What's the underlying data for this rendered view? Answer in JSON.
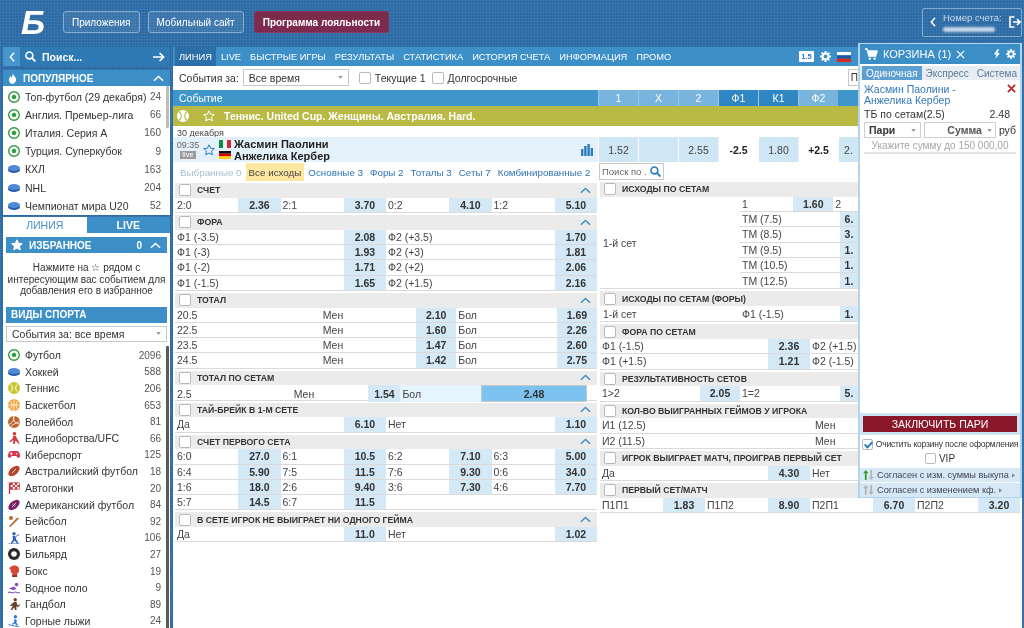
{
  "header": {
    "logo": "Б",
    "buttons": [
      {
        "label": "Приложения",
        "kind": "outline"
      },
      {
        "label": "Мобильный сайт",
        "kind": "outline"
      },
      {
        "label": "Программа лояльности",
        "kind": "primary"
      }
    ],
    "account": {
      "label": "Номер счета:"
    }
  },
  "sidebar": {
    "search": {
      "placeholder": "Поиск..."
    },
    "popular": {
      "title": "ПОПУЛЯРНОЕ",
      "expanded": true,
      "items": [
        {
          "label": "Топ-футбол (29 декабря)",
          "count": "24",
          "kind": "football"
        },
        {
          "label": "Англия. Премьер-лига",
          "count": "66",
          "kind": "football"
        },
        {
          "label": "Италия. Серия А",
          "count": "160",
          "kind": "football"
        },
        {
          "label": "Турция. Суперкубок",
          "count": "9",
          "kind": "football"
        },
        {
          "label": "КХЛ",
          "count": "163",
          "kind": "hockey"
        },
        {
          "label": "NHL",
          "count": "204",
          "kind": "hockey"
        },
        {
          "label": "Чемпионат мира U20",
          "count": "52",
          "kind": "hockey"
        }
      ]
    },
    "tabs": [
      {
        "label": "ЛИНИЯ",
        "selected": true
      },
      {
        "label": "LIVE",
        "selected": false
      }
    ],
    "favorites": {
      "title": "ИЗБРАННОЕ",
      "count": "0",
      "expanded": true,
      "hint": "Нажмите на ☆ рядом с интересующим вас событием для добавления его в избранное"
    },
    "sports": {
      "title": "ВИДЫ СПОРТА",
      "period": "События за: все время",
      "items": [
        {
          "label": "Футбол",
          "count": "2096",
          "kind": "football"
        },
        {
          "label": "Хоккей",
          "count": "588",
          "kind": "hockey"
        },
        {
          "label": "Теннис",
          "count": "206",
          "kind": "tennis"
        },
        {
          "label": "Баскетбол",
          "count": "653",
          "kind": "basketball"
        },
        {
          "label": "Волейбол",
          "count": "81",
          "kind": "volleyball"
        },
        {
          "label": "Единоборства/UFC",
          "count": "66",
          "kind": "fighting"
        },
        {
          "label": "Киберспорт",
          "count": "125",
          "kind": "esports"
        },
        {
          "label": "Австралийский футбол",
          "count": "18",
          "kind": "aussie_football"
        },
        {
          "label": "Автогонки",
          "count": "20",
          "kind": "racing"
        },
        {
          "label": "Американский футбол",
          "count": "84",
          "kind": "american_football"
        },
        {
          "label": "Бейсбол",
          "count": "92",
          "kind": "baseball"
        },
        {
          "label": "Биатлон",
          "count": "106",
          "kind": "biathlon"
        },
        {
          "label": "Бильярд",
          "count": "27",
          "kind": "billiards"
        },
        {
          "label": "Бокс",
          "count": "19",
          "kind": "boxing"
        },
        {
          "label": "Водное поло",
          "count": "9",
          "kind": "water_polo"
        },
        {
          "label": "Гандбол",
          "count": "89",
          "kind": "handball"
        },
        {
          "label": "Горные лыжи",
          "count": "24",
          "kind": "skiing"
        }
      ]
    }
  },
  "main": {
    "nav": {
      "items": [
        {
          "label": "ЛИНИЯ",
          "selected": true
        },
        {
          "label": "LIVE",
          "selected": false
        },
        {
          "label": "БЫСТРЫЕ ИГРЫ",
          "selected": false
        },
        {
          "label": "РЕЗУЛЬТАТЫ",
          "selected": false
        },
        {
          "label": "СТАТИСТИКА",
          "selected": false
        },
        {
          "label": "ИСТОРИЯ СЧЕТА",
          "selected": false
        },
        {
          "label": "ИНФОРМАЦИЯ",
          "selected": false
        },
        {
          "label": "ПРОМО",
          "selected": false
        }
      ],
      "odds_format": "1.5"
    },
    "filters": {
      "label": "События за:",
      "period": "Все время",
      "checkboxes": [
        {
          "label": "Текущие 1",
          "checked": false
        },
        {
          "label": "Долгосрочные",
          "checked": false
        }
      ],
      "cut_off_field": "П"
    },
    "event_column": "Событие",
    "odds_columns": [
      {
        "label": "1",
        "highlighted": false
      },
      {
        "label": "X",
        "highlighted": false
      },
      {
        "label": "2",
        "highlighted": false
      },
      {
        "label": "Ф1",
        "highlighted": true
      },
      {
        "label": "К1",
        "highlighted": true
      },
      {
        "label": "Ф2",
        "highlighted": false
      }
    ],
    "tournament": {
      "title": "Теннис. United Cup. Женщины. Австралия. Hard.",
      "favorite": false
    },
    "date": "30 декабря",
    "event": {
      "time": "09:35",
      "badge": "live",
      "favorite": false,
      "teams": [
        {
          "name": "Жасмин Паолини",
          "kind": "italy"
        },
        {
          "name": "Анжелика Кербер",
          "kind": "germany"
        }
      ],
      "odds": [
        {
          "kind": "odd",
          "value": "1.52"
        },
        {
          "kind": "empty"
        },
        {
          "kind": "odd",
          "value": "2.55"
        },
        {
          "kind": "handicap",
          "value": "-2.5"
        },
        {
          "kind": "odd",
          "value": "1.80"
        },
        {
          "kind": "handicap",
          "value": "+2.5"
        },
        {
          "kind": "odd",
          "value": "2."
        }
      ]
    },
    "market_tabs": [
      {
        "label": "Выбранные 0",
        "selected": false,
        "disabled": true
      },
      {
        "label": "Все исходы",
        "selected": true,
        "disabled": false
      },
      {
        "label": "Основные 3",
        "selected": false,
        "disabled": false
      },
      {
        "label": "Форы 2",
        "selected": false,
        "disabled": false
      },
      {
        "label": "Тоталы 3",
        "selected": false,
        "disabled": false
      },
      {
        "label": "Сеты 7",
        "selected": false,
        "disabled": false
      },
      {
        "label": "Комбинированные 2",
        "selected": false,
        "disabled": false
      }
    ],
    "market_search": {
      "placeholder": "Поиск по ."
    },
    "markets_left": [
      {
        "title": "СЧЕТ",
        "checked": false,
        "expanded": true,
        "kind": "quad",
        "rows": [
          {
            "outcomes": [
              {
                "label": "2:0",
                "odd": "2.36",
                "selected": false
              },
              {
                "label": "2:1",
                "odd": "3.70",
                "selected": false
              },
              {
                "label": "0:2",
                "odd": "4.10",
                "selected": false
              },
              {
                "label": "1:2",
                "odd": "5.10",
                "selected": false
              }
            ]
          }
        ]
      },
      {
        "title": "ФОРА",
        "checked": false,
        "expanded": true,
        "kind": "pair",
        "rows": [
          {
            "outcomes": [
              {
                "label": "Ф1 (-3.5)",
                "odd": "2.08",
                "selected": false
              },
              {
                "label": "Ф2 (+3.5)",
                "odd": "1.70",
                "selected": false
              }
            ]
          },
          {
            "outcomes": [
              {
                "label": "Ф1 (-3)",
                "odd": "1.93",
                "selected": false
              },
              {
                "label": "Ф2 (+3)",
                "odd": "1.81",
                "selected": false
              }
            ]
          },
          {
            "outcomes": [
              {
                "label": "Ф1 (-2)",
                "odd": "1.71",
                "selected": false
              },
              {
                "label": "Ф2 (+2)",
                "odd": "2.06",
                "selected": false
              }
            ]
          },
          {
            "outcomes": [
              {
                "label": "Ф1 (-1.5)",
                "odd": "1.65",
                "selected": false
              },
              {
                "label": "Ф2 (+1.5)",
                "odd": "2.16",
                "selected": false
              }
            ]
          }
        ]
      },
      {
        "title": "ТОТАЛ",
        "checked": false,
        "expanded": true,
        "kind": "total",
        "rows": [
          {
            "label": "20.5",
            "outcomes": [
              {
                "label": "Мен",
                "odd": "2.10",
                "selected": false
              },
              {
                "label": "Бол",
                "odd": "1.69",
                "selected": false
              }
            ]
          },
          {
            "label": "22.5",
            "outcomes": [
              {
                "label": "Мен",
                "odd": "1.60",
                "selected": false
              },
              {
                "label": "Бол",
                "odd": "2.26",
                "selected": false
              }
            ]
          },
          {
            "label": "23.5",
            "outcomes": [
              {
                "label": "Мен",
                "odd": "1.47",
                "selected": false
              },
              {
                "label": "Бол",
                "odd": "2.60",
                "selected": false
              }
            ]
          },
          {
            "label": "24.5",
            "outcomes": [
              {
                "label": "Мен",
                "odd": "1.42",
                "selected": false
              },
              {
                "label": "Бол",
                "odd": "2.75",
                "selected": false
              }
            ]
          }
        ]
      },
      {
        "title": "ТОТАЛ ПО СЕТАМ",
        "checked": false,
        "expanded": true,
        "kind": "total",
        "rows": [
          {
            "label": "2.5",
            "outcomes": [
              {
                "label": "Мен",
                "odd": "1.54",
                "selected": false
              },
              {
                "label": "Бол",
                "odd": "2.48",
                "selected": true
              }
            ]
          }
        ]
      },
      {
        "title": "ТАЙ-БРЕЙК В 1-М СЕТЕ",
        "checked": false,
        "expanded": true,
        "kind": "pair",
        "rows": [
          {
            "outcomes": [
              {
                "label": "Да",
                "odd": "6.10",
                "selected": false
              },
              {
                "label": "Нет",
                "odd": "1.10",
                "selected": false
              }
            ]
          }
        ]
      },
      {
        "title": "СЧЕТ ПЕРВОГО СЕТА",
        "checked": false,
        "expanded": true,
        "kind": "quad",
        "rows": [
          {
            "outcomes": [
              {
                "label": "6:0",
                "odd": "27.0",
                "selected": false
              },
              {
                "label": "6:1",
                "odd": "10.5",
                "selected": false
              },
              {
                "label": "6:2",
                "odd": "7.10",
                "selected": false
              },
              {
                "label": "6:3",
                "odd": "5.00",
                "selected": false
              }
            ]
          },
          {
            "outcomes": [
              {
                "label": "6:4",
                "odd": "5.90",
                "selected": false
              },
              {
                "label": "7:5",
                "odd": "11.5",
                "selected": false
              },
              {
                "label": "7:6",
                "odd": "9.30",
                "selected": false
              },
              {
                "label": "0:6",
                "odd": "34.0",
                "selected": false
              }
            ]
          },
          {
            "outcomes": [
              {
                "label": "1:6",
                "odd": "18.0",
                "selected": false
              },
              {
                "label": "2:6",
                "odd": "9.40",
                "selected": false
              },
              {
                "label": "3:6",
                "odd": "7.30",
                "selected": false
              },
              {
                "label": "4:6",
                "odd": "7.70",
                "selected": false
              }
            ]
          },
          {
            "outcomes": [
              {
                "label": "5:7",
                "odd": "14.5",
                "selected": false
              },
              {
                "label": "6:7",
                "odd": "11.5",
                "selected": false
              }
            ]
          }
        ]
      },
      {
        "title": "В СЕТЕ ИГРОК НЕ ВЫИГРАЕТ НИ ОДНОГО ГЕЙМА",
        "checked": false,
        "expanded": true,
        "kind": "pair",
        "rows": [
          {
            "outcomes": [
              {
                "label": "Да",
                "odd": "11.0",
                "selected": false
              },
              {
                "label": "Нет",
                "odd": "1.02",
                "selected": false
              }
            ]
          }
        ]
      }
    ],
    "markets_right": [
      {
        "title": "ИСХОДЫ ПО СЕТАМ",
        "checked": false,
        "kind": "grouped",
        "rows": [
          {
            "label": "1-й сет",
            "subrows": [
              {
                "kind": "three_way",
                "outcomes": [
                  {
                    "label": "1",
                    "odd": "1.60",
                    "selected": false
                  },
                  {
                    "label": "2"
                  }
                ]
              },
              {
                "kind": "two_way",
                "outcomes": [
                  {
                    "label": "ТМ (7.5)",
                    "odd": "6.",
                    "selected": false
                  }
                ]
              },
              {
                "kind": "two_way",
                "outcomes": [
                  {
                    "label": "ТМ (8.5)",
                    "odd": "3.",
                    "selected": false
                  }
                ]
              },
              {
                "kind": "two_way",
                "outcomes": [
                  {
                    "label": "ТМ (9.5)",
                    "odd": "1.",
                    "selected": false
                  }
                ]
              },
              {
                "kind": "two_way",
                "outcomes": [
                  {
                    "label": "ТМ (10.5)",
                    "odd": "1.",
                    "selected": false
                  }
                ]
              },
              {
                "kind": "two_way",
                "outcomes": [
                  {
                    "label": "ТМ (12.5)",
                    "odd": "1.",
                    "selected": false
                  }
                ]
              }
            ]
          }
        ]
      },
      {
        "title": "ИСХОДЫ ПО СЕТАМ (ФОРЫ)",
        "checked": false,
        "kind": "grouped",
        "rows": [
          {
            "label": "1-й сет",
            "subrows": [
              {
                "kind": "two_way",
                "outcomes": [
                  {
                    "label": "Ф1 (-1.5)",
                    "odd": "1.",
                    "selected": false
                  }
                ]
              }
            ]
          }
        ]
      },
      {
        "title": "ФОРА ПО СЕТАМ",
        "checked": false,
        "kind": "pair",
        "rows": [
          {
            "outcomes": [
              {
                "label": "Ф1 (-1.5)",
                "odd": "2.36",
                "selected": false
              },
              {
                "label": "Ф2 (+1.5)"
              }
            ]
          },
          {
            "outcomes": [
              {
                "label": "Ф1 (+1.5)",
                "odd": "1.21",
                "selected": false
              },
              {
                "label": "Ф2 (-1.5)"
              }
            ]
          }
        ]
      },
      {
        "title": "РЕЗУЛЬТАТИВНОСТЬ СЕТОВ",
        "checked": false,
        "kind": "trio",
        "rows": [
          {
            "outcomes": [
              {
                "label": "1>2",
                "odd": "2.05",
                "selected": false
              },
              {
                "label": "1=2",
                "odd": "5.",
                "selected": false
              }
            ]
          }
        ]
      },
      {
        "title": "КОЛ-ВО ВЫИГРАННЫХ ГЕЙМОВ У ИГРОКА",
        "checked": false,
        "kind": "total_wide",
        "rows": [
          {
            "label": "И1 (12.5)",
            "outcomes": [
              {
                "label": "Мен"
              }
            ]
          },
          {
            "label": "И2 (11.5)",
            "outcomes": [
              {
                "label": "Мен"
              }
            ]
          }
        ]
      },
      {
        "title": "ИГРОК ВЫИГРАЕТ МАТЧ, ПРОИГРАВ ПЕРВЫЙ СЕТ",
        "checked": false,
        "kind": "pair",
        "rows": [
          {
            "outcomes": [
              {
                "label": "Да",
                "odd": "4.30",
                "selected": false
              },
              {
                "label": "Нет"
              }
            ]
          }
        ]
      },
      {
        "title": "ПЕРВЫЙ СЕТ/МАТЧ",
        "checked": false,
        "kind": "quad",
        "rows": [
          {
            "outcomes": [
              {
                "label": "П1П1",
                "odd": "1.83",
                "selected": false
              },
              {
                "label": "П1П2",
                "odd": "8.90",
                "selected": false
              },
              {
                "label": "П2П1",
                "odd": "6.70",
                "selected": false
              },
              {
                "label": "П2П2",
                "odd": "3.20",
                "selected": false
              }
            ]
          }
        ]
      }
    ]
  },
  "basket": {
    "title": "КОРЗИНА (1)",
    "tabs": [
      {
        "label": "Одиночная",
        "selected": true
      },
      {
        "label": "Экспресс",
        "selected": false
      },
      {
        "label": "Система",
        "selected": false
      }
    ],
    "bet": {
      "event": "Жасмин Паолини - Анжелика Кербер",
      "market": "ТБ по сетам(2.5)",
      "odd": "2.48"
    },
    "bet_type": "Пари",
    "amount": {
      "placeholder": "Сумма"
    },
    "currency": "руб",
    "hint": "Укажите сумму до 150 000,00",
    "submit": "ЗАКЛЮЧИТЬ ПАРИ",
    "options": [
      {
        "label": "Очистить корзину после оформления",
        "checked": true
      },
      {
        "label": "VIP",
        "checked": false
      }
    ],
    "agreements": [
      {
        "label": "Согласен с изм. суммы выкупа",
        "active": true
      },
      {
        "label": "Согласен с изменением кф.",
        "active": false
      }
    ]
  }
}
